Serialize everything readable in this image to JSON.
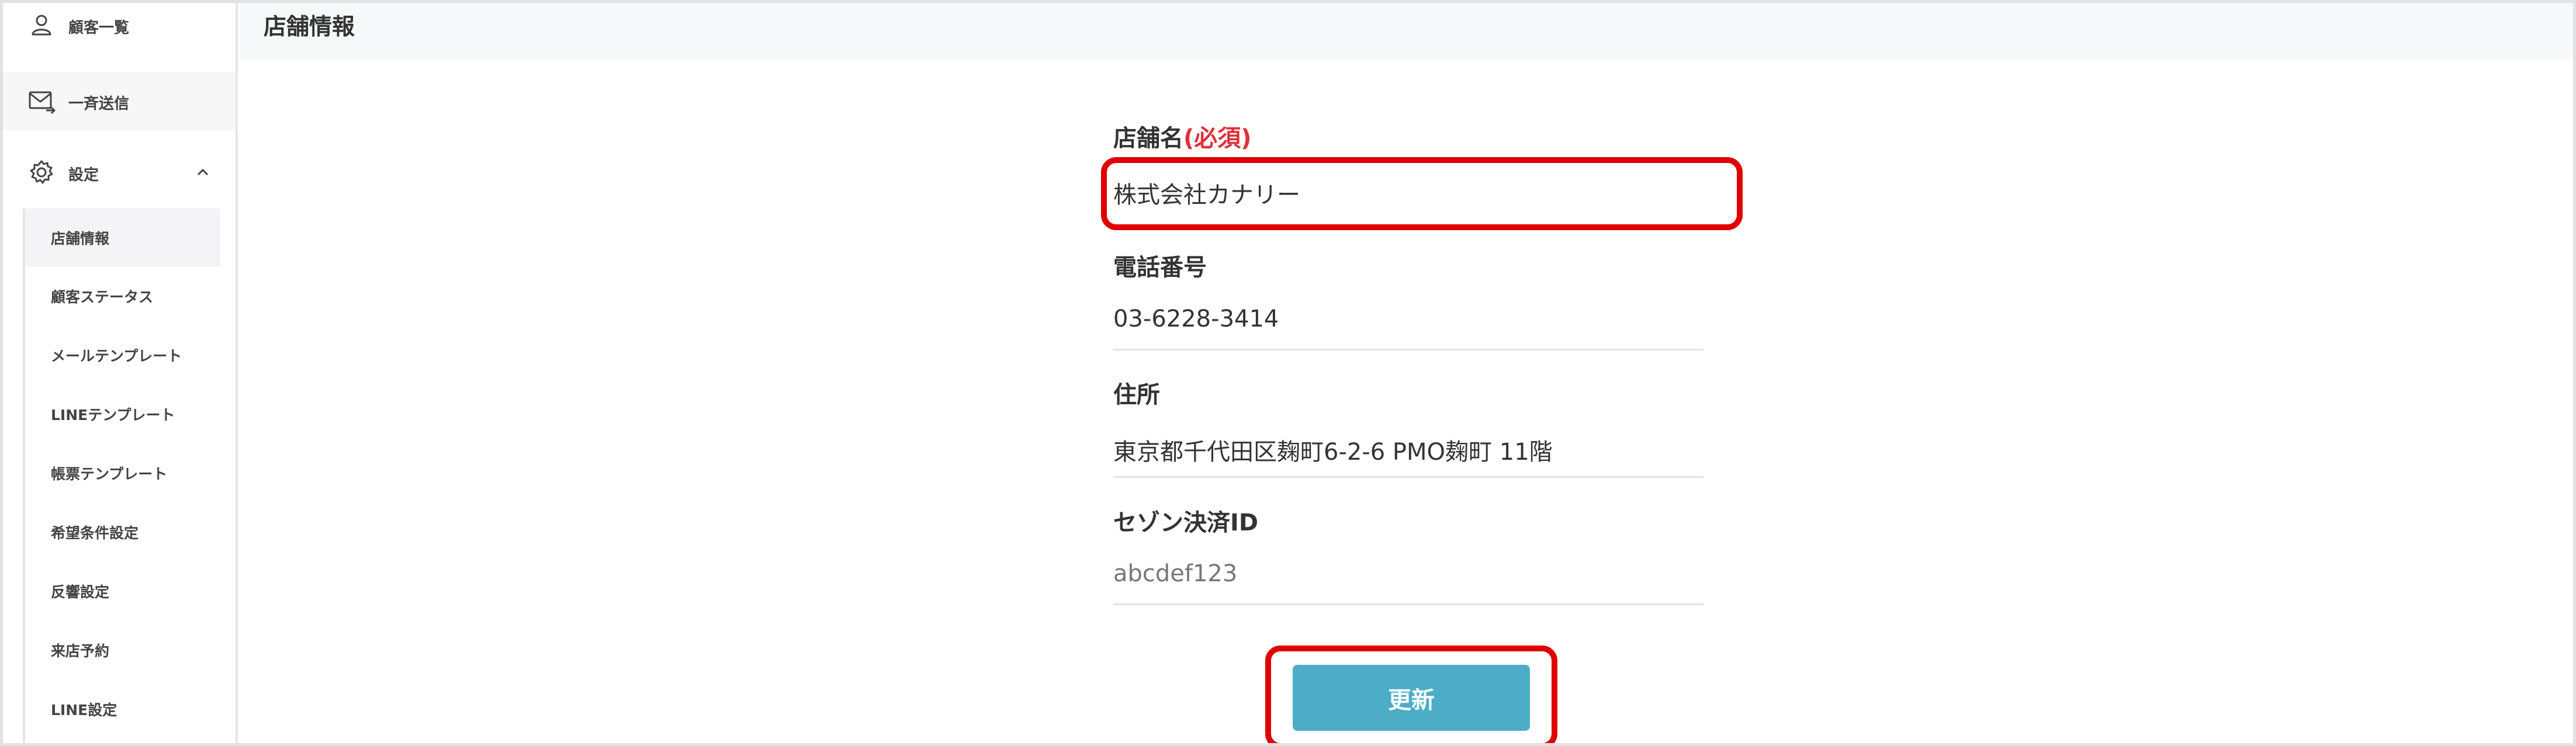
{
  "sidebar": {
    "customers_label": "顧客一覧",
    "broadcast_label": "一斉送信",
    "settings_label": "設定",
    "submenu": [
      "店舗情報",
      "顧客ステータス",
      "メールテンプレート",
      "LINEテンプレート",
      "帳票テンプレート",
      "希望条件設定",
      "反響設定",
      "来店予約",
      "LINE設定"
    ],
    "active_submenu_index": 0
  },
  "page": {
    "title": "店舗情報"
  },
  "form": {
    "store_name": {
      "label": "店舗名",
      "required_mark": "(必須)",
      "value": "株式会社カナリー"
    },
    "phone": {
      "label": "電話番号",
      "value": "03-6228-3414"
    },
    "address": {
      "label": "住所",
      "value": "東京都千代田区麹町6-2-6 PMO麹町 11階"
    },
    "saison_id": {
      "label": "セゾン決済ID",
      "placeholder": "abcdef123"
    },
    "update_label": "更新"
  },
  "colors": {
    "accent": "#4dadc6",
    "required": "#e0303a",
    "highlight": "#e00000"
  }
}
